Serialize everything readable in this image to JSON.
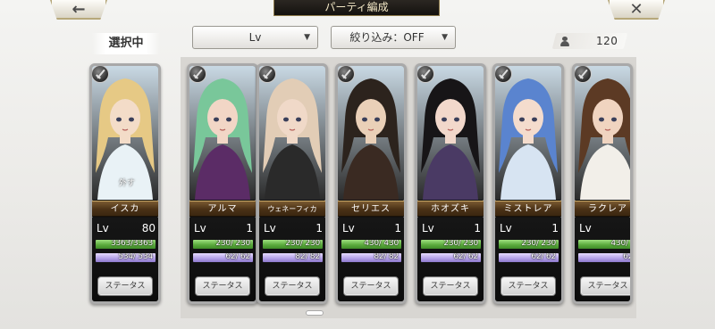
{
  "header": {
    "back_icon": "left-arrow-icon",
    "close_icon": "close-x-icon",
    "title": "パーティ編成"
  },
  "selected_label": "選択中",
  "sort_dropdown": {
    "value": "Lv",
    "icon": "triangle-down-icon"
  },
  "filter_dropdown": {
    "value": "絞り込み：OFF",
    "icon": "triangle-down-icon"
  },
  "unit_count": {
    "icon": "person-icon",
    "value": "120"
  },
  "colors": {
    "hp_bar": "#5cac3e",
    "mp_bar": "#b6a4e8",
    "name_bar": "#4a3116",
    "card_frame": "#a9a9a9"
  },
  "selected_card": {
    "name": "イスカ",
    "lv_label": "Lv",
    "lv": "80",
    "hp_text": "3363/3363",
    "hp_fraction": 1.0,
    "mp_text": "534/ 534",
    "mp_fraction": 1.0,
    "note": "外す",
    "status_label": "ステータス",
    "badge_icon": "sword-class-icon",
    "hair": "#e6c985",
    "skin": "#f3dcc8",
    "cloth": "#e9f2f6",
    "bg": "#c9d9e4"
  },
  "cards": [
    {
      "name": "アルマ",
      "lv_label": "Lv",
      "lv": "1",
      "hp_text": "230/ 230",
      "hp_fraction": 1.0,
      "mp_text": "62/ 62",
      "mp_fraction": 1.0,
      "status_label": "ステータス",
      "badge_icon": "lance-class-icon",
      "hair": "#79c79a",
      "skin": "#f2d6c6",
      "cloth": "#5b2c66",
      "bg": "#d7c6d2"
    },
    {
      "name": "ウェネーフィカ",
      "lv_label": "Lv",
      "lv": "1",
      "hp_text": "230/ 230",
      "hp_fraction": 1.0,
      "mp_text": "82/ 82",
      "mp_fraction": 1.0,
      "status_label": "ステータス",
      "badge_icon": "lance-class-icon",
      "hair": "#e2cdb6",
      "skin": "#f0d9c8",
      "cloth": "#2a2a2a",
      "bg": "#c8c1b8"
    },
    {
      "name": "セリエス",
      "lv_label": "Lv",
      "lv": "1",
      "hp_text": "430/ 430",
      "hp_fraction": 1.0,
      "mp_text": "82/ 82",
      "mp_fraction": 1.0,
      "status_label": "ステータス",
      "badge_icon": "lance-class-icon",
      "hair": "#2c231d",
      "skin": "#ead0b8",
      "cloth": "#3a2a22",
      "bg": "#b6a89a"
    },
    {
      "name": "ホオズキ",
      "lv_label": "Lv",
      "lv": "1",
      "hp_text": "230/ 230",
      "hp_fraction": 1.0,
      "mp_text": "62/ 62",
      "mp_fraction": 1.0,
      "status_label": "ステータス",
      "badge_icon": "lance-class-icon",
      "hair": "#171517",
      "skin": "#f2d8cb",
      "cloth": "#4a3a64",
      "bg": "#9aa38d"
    },
    {
      "name": "ミストレア",
      "lv_label": "Lv",
      "lv": "1",
      "hp_text": "230/ 230",
      "hp_fraction": 1.0,
      "mp_text": "62/ 62",
      "mp_fraction": 1.0,
      "status_label": "ステータス",
      "badge_icon": "lance-class-icon",
      "hair": "#5a84cf",
      "skin": "#f4dccd",
      "cloth": "#d7e4f2",
      "bg": "#a7c1e0"
    },
    {
      "name": "ラクレア",
      "lv_label": "Lv",
      "lv": "1",
      "hp_text": "430/ 4",
      "hp_fraction": 1.0,
      "mp_text": "62/",
      "mp_fraction": 1.0,
      "status_label": "ステータス",
      "badge_icon": "lance-class-icon",
      "hair": "#5c3a24",
      "skin": "#f0d4c0",
      "cloth": "#f2efe9",
      "bg": "#c7b9a9"
    }
  ]
}
